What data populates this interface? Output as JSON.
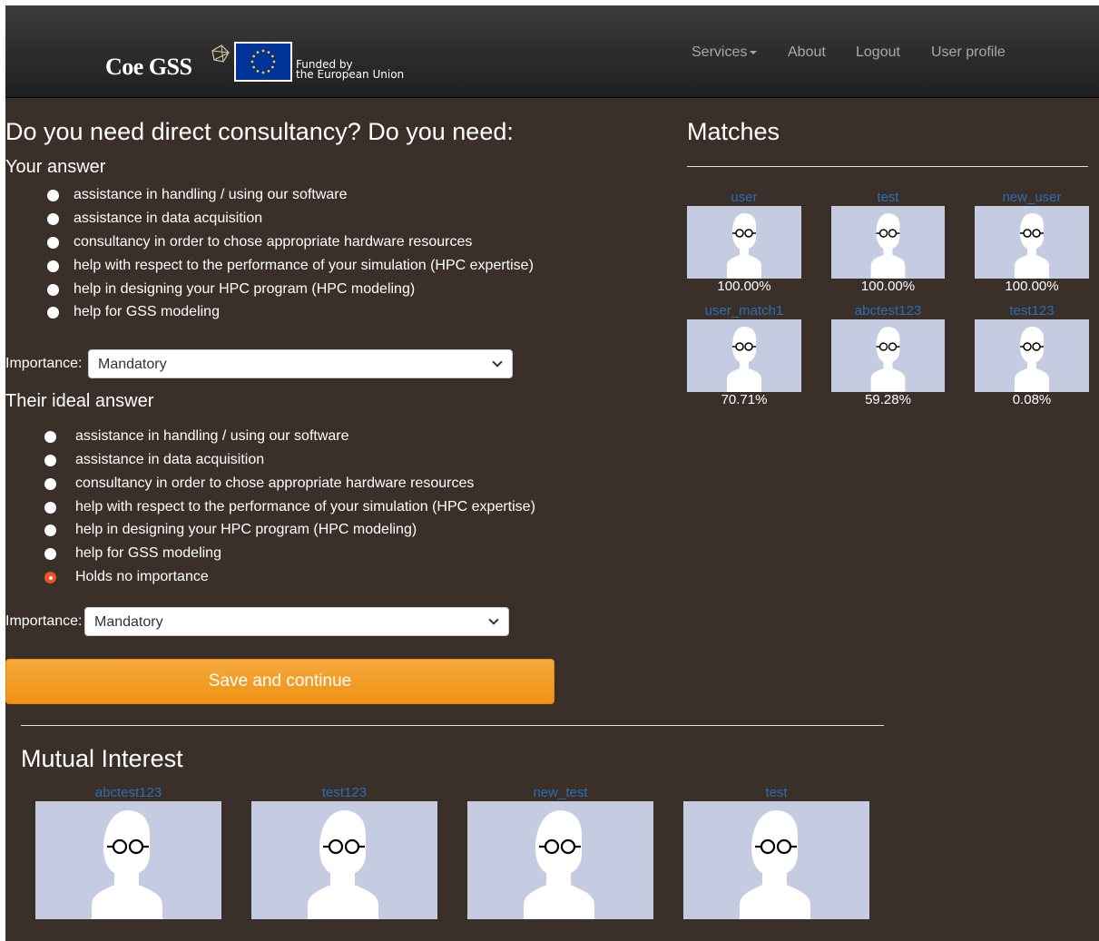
{
  "navbar": {
    "logo_text": "Coe GSS",
    "eu_text_line1": "Funded by",
    "eu_text_line2": "the European Union",
    "links": [
      {
        "label": "Services",
        "dropdown": true
      },
      {
        "label": "About"
      },
      {
        "label": "Logout"
      },
      {
        "label": "User profile"
      }
    ]
  },
  "question": {
    "title": "Do you need direct consultancy? Do you need:",
    "your_answer": {
      "heading": "Your answer",
      "options": [
        "assistance in handling / using our software",
        "assistance in data acquisition",
        "consultancy in order to chose appropriate hardware resources",
        "help with respect to the performance of your simulation (HPC expertise)",
        "help in designing your HPC program (HPC modeling)",
        "help for GSS modeling"
      ],
      "importance_label": "Importance:",
      "importance_value": "Mandatory"
    },
    "ideal_answer": {
      "heading": "Their ideal answer",
      "options": [
        "assistance in handling / using our software",
        "assistance in data acquisition",
        "consultancy in order to chose appropriate hardware resources",
        "help with respect to the performance of your simulation (HPC expertise)",
        "help in designing your HPC program (HPC modeling)",
        "help for GSS modeling",
        "Holds no importance"
      ],
      "selected": "Holds no importance",
      "importance_label": "Importance:",
      "importance_value": "Mandatory"
    },
    "save_label": "Save and continue"
  },
  "matches": {
    "title": "Matches",
    "items": [
      {
        "name": "user",
        "score": "100.00%"
      },
      {
        "name": "test",
        "score": "100.00%"
      },
      {
        "name": "new_user",
        "score": "100.00%"
      },
      {
        "name": "user_match1",
        "score": "70.71%"
      },
      {
        "name": "abctest123",
        "score": "59.28%"
      },
      {
        "name": "test123",
        "score": "0.08%"
      }
    ]
  },
  "mutual": {
    "title": "Mutual Interest",
    "items": [
      {
        "name": "abctest123"
      },
      {
        "name": "test123"
      },
      {
        "name": "new_test"
      },
      {
        "name": "test"
      }
    ]
  },
  "colors": {
    "page_bg": "#3a3029",
    "navbar_bg": "#2a2a2a",
    "link_blue": "#2a6eb3",
    "button_orange": "#f39c1e",
    "radio_selected": "#e95420",
    "avatar_bg": "#c5cbe0"
  }
}
